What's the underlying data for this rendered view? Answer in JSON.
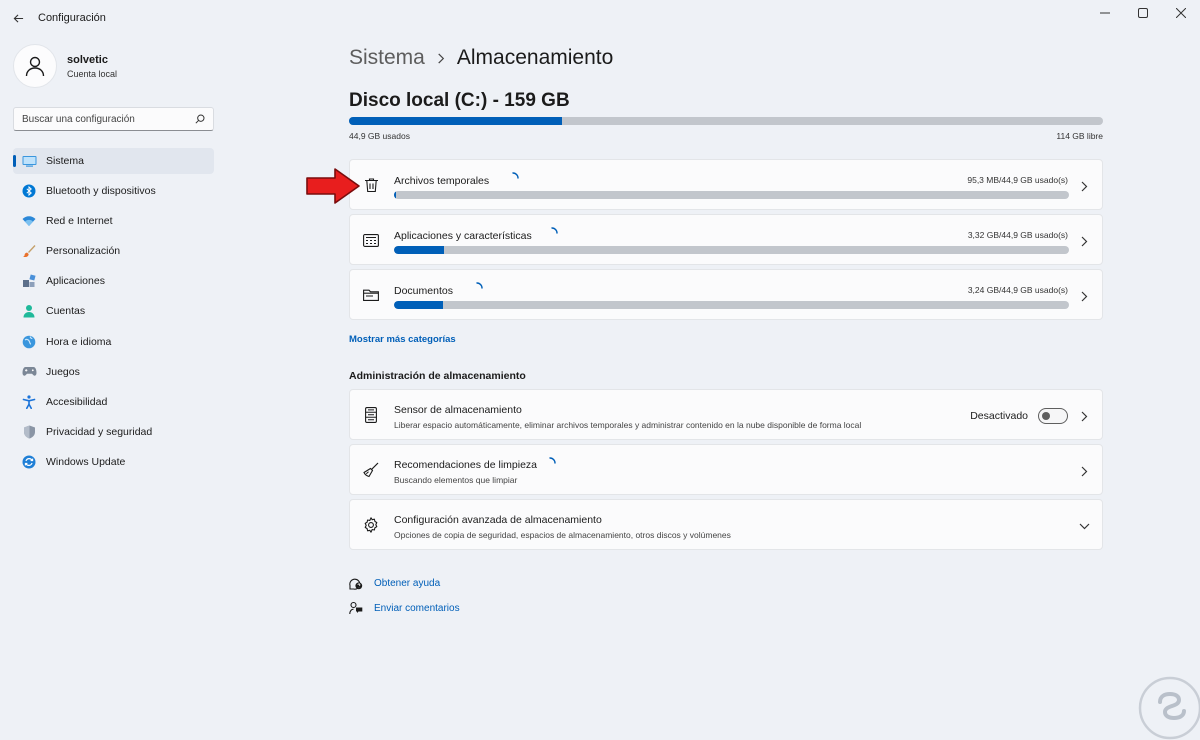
{
  "window": {
    "title": "Configuración"
  },
  "profile": {
    "name": "solvetic",
    "account": "Cuenta local"
  },
  "search": {
    "placeholder": "Buscar una configuración"
  },
  "nav": [
    {
      "label": "Sistema",
      "icon": "monitor-icon",
      "active": true
    },
    {
      "label": "Bluetooth y dispositivos",
      "icon": "bluetooth-icon"
    },
    {
      "label": "Red e Internet",
      "icon": "wifi-icon"
    },
    {
      "label": "Personalización",
      "icon": "brush-icon"
    },
    {
      "label": "Aplicaciones",
      "icon": "apps-icon"
    },
    {
      "label": "Cuentas",
      "icon": "person-icon"
    },
    {
      "label": "Hora e idioma",
      "icon": "globe-icon"
    },
    {
      "label": "Juegos",
      "icon": "gamepad-icon"
    },
    {
      "label": "Accesibilidad",
      "icon": "accessibility-icon"
    },
    {
      "label": "Privacidad y seguridad",
      "icon": "shield-icon"
    },
    {
      "label": "Windows Update",
      "icon": "update-icon"
    }
  ],
  "breadcrumb": {
    "parent": "Sistema",
    "current": "Almacenamiento"
  },
  "disk": {
    "title": "Disco local (C:) - 159 GB",
    "used_label": "44,9 GB usados",
    "free_label": "114 GB libre",
    "used_fraction": 0.283
  },
  "categories": [
    {
      "title": "Archivos temporales",
      "size": "95,3 MB/44,9 GB usado(s)",
      "fraction": 0.002,
      "icon": "trash-icon"
    },
    {
      "title": "Aplicaciones y características",
      "size": "3,32 GB/44,9 GB usado(s)",
      "fraction": 0.074,
      "icon": "apps-list-icon"
    },
    {
      "title": "Documentos",
      "size": "3,24 GB/44,9 GB usado(s)",
      "fraction": 0.072,
      "icon": "folder-icon"
    }
  ],
  "more_categories": "Mostrar más categorías",
  "management": {
    "title": "Administración de almacenamiento",
    "sensor": {
      "title": "Sensor de almacenamiento",
      "subtitle": "Liberar espacio automáticamente, eliminar archivos temporales y administrar contenido en la nube disponible de forma local",
      "toggle_label": "Desactivado",
      "toggle_on": false
    },
    "cleanup": {
      "title": "Recomendaciones de limpieza",
      "subtitle": "Buscando elementos que limpiar"
    },
    "advanced": {
      "title": "Configuración avanzada de almacenamiento",
      "subtitle": "Opciones de copia de seguridad, espacios de almacenamiento, otros discos y volúmenes"
    }
  },
  "help": {
    "get_help": "Obtener ayuda",
    "feedback": "Enviar comentarios"
  },
  "colors": {
    "accent": "#005fb8",
    "bar_track": "#c2c6cc",
    "background": "#eef1f6",
    "card": "#fbfbfc",
    "arrow": "#e81e1e"
  }
}
